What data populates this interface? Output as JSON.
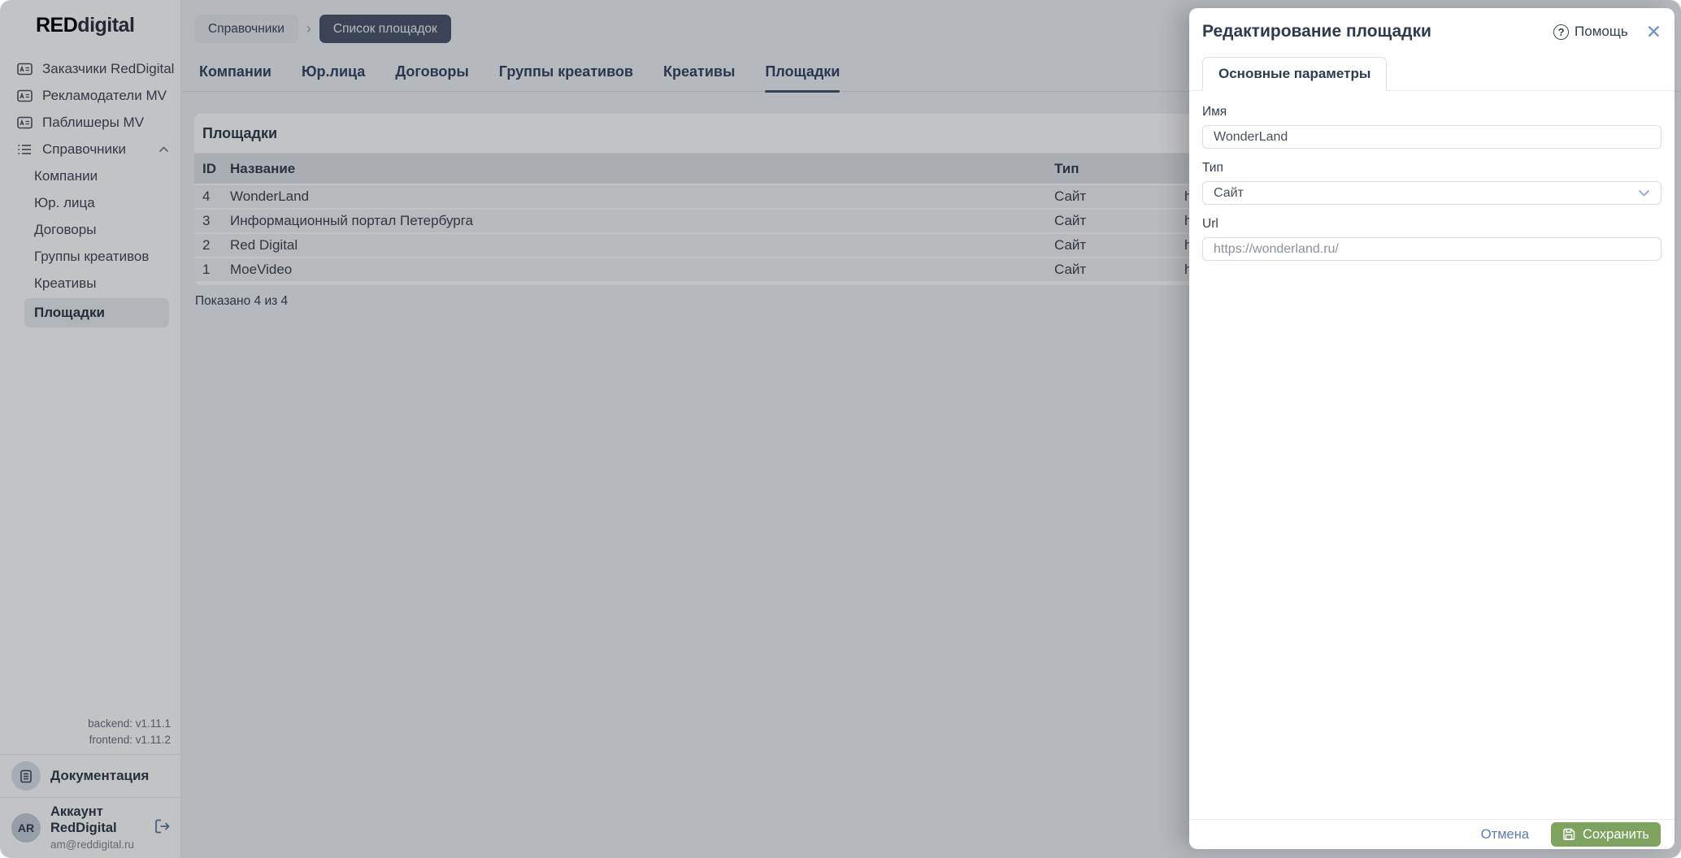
{
  "logo": {
    "red": "RED",
    "rest": "digital"
  },
  "sidebar": {
    "items": [
      {
        "label": "Заказчики RedDigital",
        "icon": "ad-card-icon"
      },
      {
        "label": "Рекламодатели MV",
        "icon": "ad-card-icon"
      },
      {
        "label": "Паблишеры MV",
        "icon": "ad-card-icon"
      },
      {
        "label": "Справочники",
        "icon": "list-icon",
        "expanded": true
      }
    ],
    "subitems": [
      {
        "label": "Компании"
      },
      {
        "label": "Юр. лица"
      },
      {
        "label": "Договоры"
      },
      {
        "label": "Группы креативов"
      },
      {
        "label": "Креативы"
      },
      {
        "label": "Площадки",
        "active": true
      }
    ],
    "versions": {
      "backend": "backend: v1.11.1",
      "frontend": "frontend: v1.11.2"
    },
    "documentation_label": "Документация",
    "account": {
      "initials": "AR",
      "name": "Аккаунт RedDigital",
      "email": "am@reddigital.ru"
    }
  },
  "breadcrumbs": {
    "first": "Справочники",
    "second": "Список площадок"
  },
  "tabs": [
    {
      "label": "Компании"
    },
    {
      "label": "Юр.лица"
    },
    {
      "label": "Договоры"
    },
    {
      "label": "Группы креативов"
    },
    {
      "label": "Креативы"
    },
    {
      "label": "Площадки",
      "active": true
    }
  ],
  "table": {
    "title": "Площадки",
    "columns": {
      "id": "ID",
      "name": "Название",
      "type": "Тип"
    },
    "rows": [
      {
        "id": "4",
        "name": "WonderLand",
        "type": "Сайт"
      },
      {
        "id": "3",
        "name": "Информационный портал Петербурга",
        "type": "Сайт"
      },
      {
        "id": "2",
        "name": "Red Digital",
        "type": "Сайт"
      },
      {
        "id": "1",
        "name": "MoeVideo",
        "type": "Сайт"
      }
    ],
    "url_clipped_text": "h",
    "footer": "Показано 4 из 4"
  },
  "drawer": {
    "title": "Редактирование площадки",
    "help_label": "Помощь",
    "tab": "Основные параметры",
    "fields": {
      "name_label": "Имя",
      "name_value": "WonderLand",
      "type_label": "Тип",
      "type_value": "Сайт",
      "url_label": "Url",
      "url_value": "https://wonderland.ru/"
    },
    "cancel_label": "Отмена",
    "save_label": "Сохранить"
  },
  "icons": {
    "help": "?",
    "close": "✕",
    "crumb_sep": "›"
  },
  "colors": {
    "brand_red": "#d9252c",
    "dark_navy": "#35455e",
    "breadcrumb_dark": "#4b5669",
    "link_blue": "#5a7db3",
    "save_green": "#7da35f",
    "overlay": "rgba(12,16,23,0.25)",
    "table_header_bg": "#e1e4e9",
    "table_row_bg": "#f1f2f4"
  }
}
